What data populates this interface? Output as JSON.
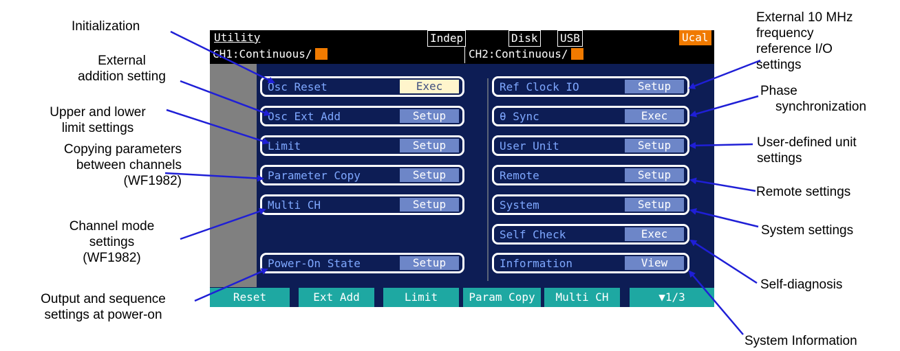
{
  "screen": {
    "title": "Utility",
    "status": {
      "mode": "Indep",
      "disk": "Disk",
      "usb": "USB",
      "ucal": "Ucal"
    },
    "ch1": "CH1:Continuous/",
    "ch2": "CH2:Continuous/",
    "left_buttons": [
      {
        "label": "Osc Reset",
        "action": "Exec"
      },
      {
        "label": "Osc Ext Add",
        "action": "Setup"
      },
      {
        "label": "Limit",
        "action": "Setup"
      },
      {
        "label": "Parameter Copy",
        "action": "Setup"
      },
      {
        "label": "Multi CH",
        "action": "Setup"
      },
      {
        "label": "Power-On State",
        "action": "Setup"
      }
    ],
    "right_buttons": [
      {
        "label": "Ref Clock IO",
        "action": "Setup"
      },
      {
        "label": "θ Sync",
        "action": "Exec"
      },
      {
        "label": "User Unit",
        "action": "Setup"
      },
      {
        "label": "Remote",
        "action": "Setup"
      },
      {
        "label": "System",
        "action": "Setup"
      },
      {
        "label": "Self Check",
        "action": "Exec"
      },
      {
        "label": "Information",
        "action": "View"
      }
    ],
    "softkeys": [
      "Reset",
      "Ext Add",
      "Limit",
      "Param Copy",
      "Multi CH",
      "▼1/3"
    ],
    "colors": {
      "background": "#0d1d55",
      "label": "#7fa8ff",
      "action_button": "#6d86c8",
      "softkey": "#1ea8a2",
      "accent": "#f07a00"
    }
  },
  "annotations": {
    "initialization": "Initialization",
    "external_addition": [
      "External",
      "addition setting"
    ],
    "limit": [
      "Upper and lower",
      "limit settings"
    ],
    "copy": [
      "Copying parameters",
      "between channels",
      "(WF1982)"
    ],
    "channel_mode": [
      "Channel mode",
      "settings",
      "(WF1982)"
    ],
    "power_on": [
      "Output and sequence",
      "settings at power-on"
    ],
    "ref_clock": [
      "External 10 MHz",
      "frequency",
      "reference I/O",
      "settings"
    ],
    "phase": [
      "Phase",
      "synchronization"
    ],
    "user_unit": [
      "User-defined unit",
      "settings"
    ],
    "remote": "Remote settings",
    "system": "System settings",
    "self_diag": "Self-diagnosis",
    "system_info": "System Information"
  }
}
